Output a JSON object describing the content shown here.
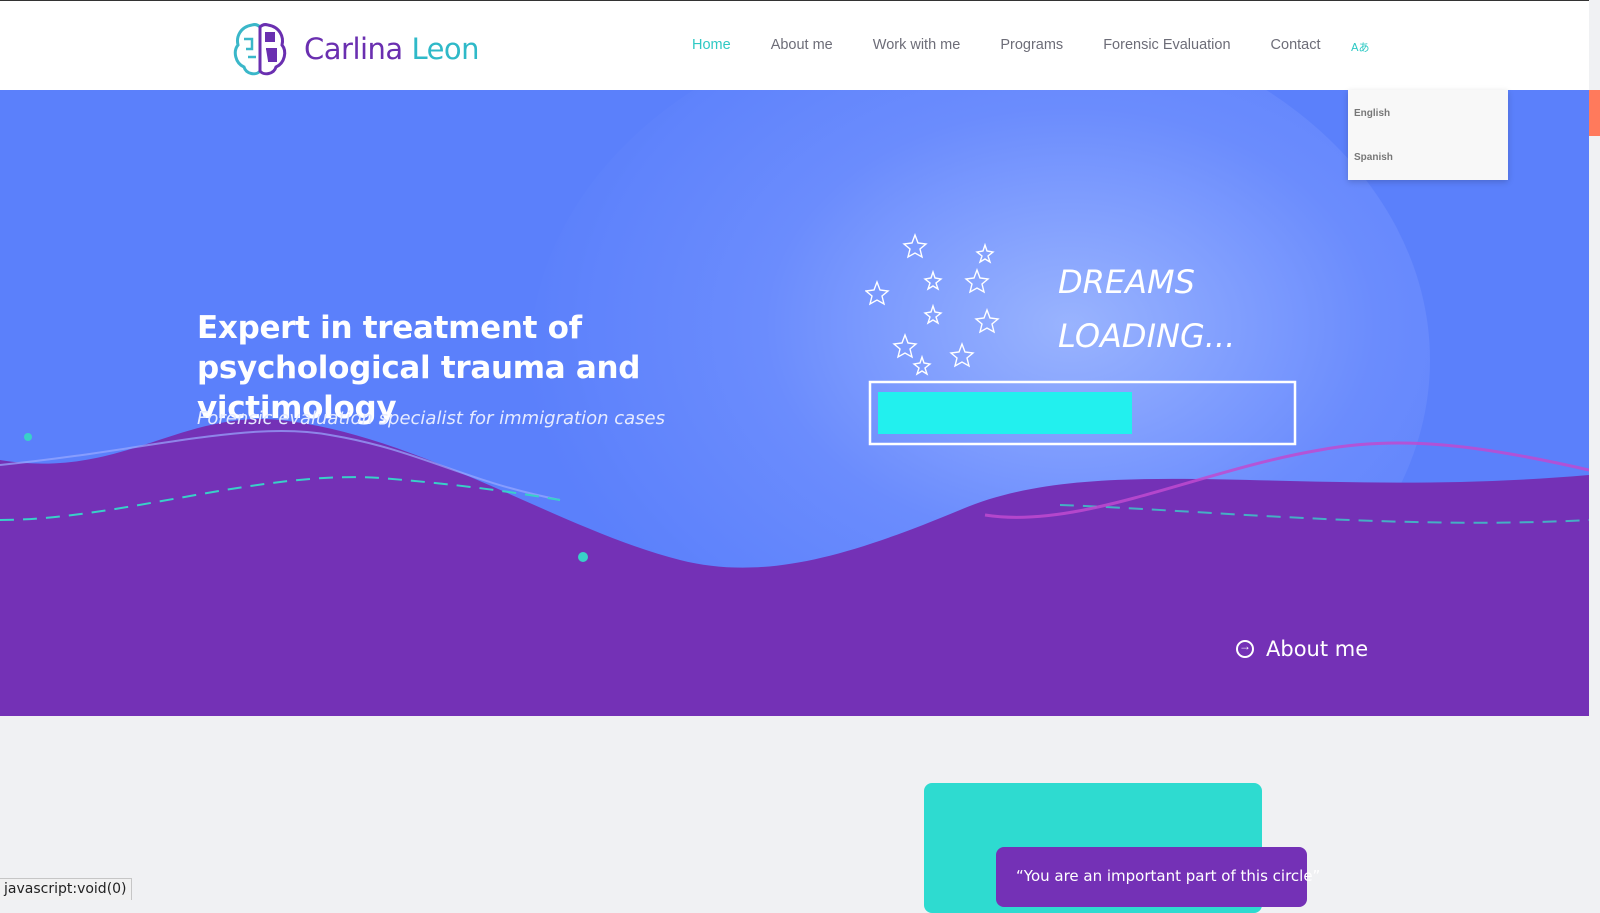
{
  "brand": {
    "first": "Carlina",
    "last": "Leon"
  },
  "nav": {
    "items": [
      {
        "label": "Home"
      },
      {
        "label": "About me"
      },
      {
        "label": "Work with me"
      },
      {
        "label": "Programs"
      },
      {
        "label": "Forensic Evaluation"
      },
      {
        "label": "Contact"
      }
    ],
    "active_index": 0,
    "lang_icon": "translate-icon"
  },
  "language_menu": {
    "options": [
      "English",
      "Spanish"
    ]
  },
  "hero": {
    "title": "Expert in treatment of psychological trauma and victimology",
    "subtitle": "Forensic evaluation specialist for immigration cases",
    "art_line1": "DREAMS",
    "art_line2": "LOADING...",
    "loading_progress": 0.62,
    "about_link": "About me"
  },
  "quote": {
    "text": "“You are an important part of this circle”"
  },
  "status_bar": {
    "text": "javascript:void(0)"
  },
  "colors": {
    "accent": "#2ec9c4",
    "hero_blue": "#5b80fb",
    "hero_purple": "#7431b6",
    "quote_teal": "#2edbd0",
    "scroll_thumb": "#ff7a5c"
  }
}
